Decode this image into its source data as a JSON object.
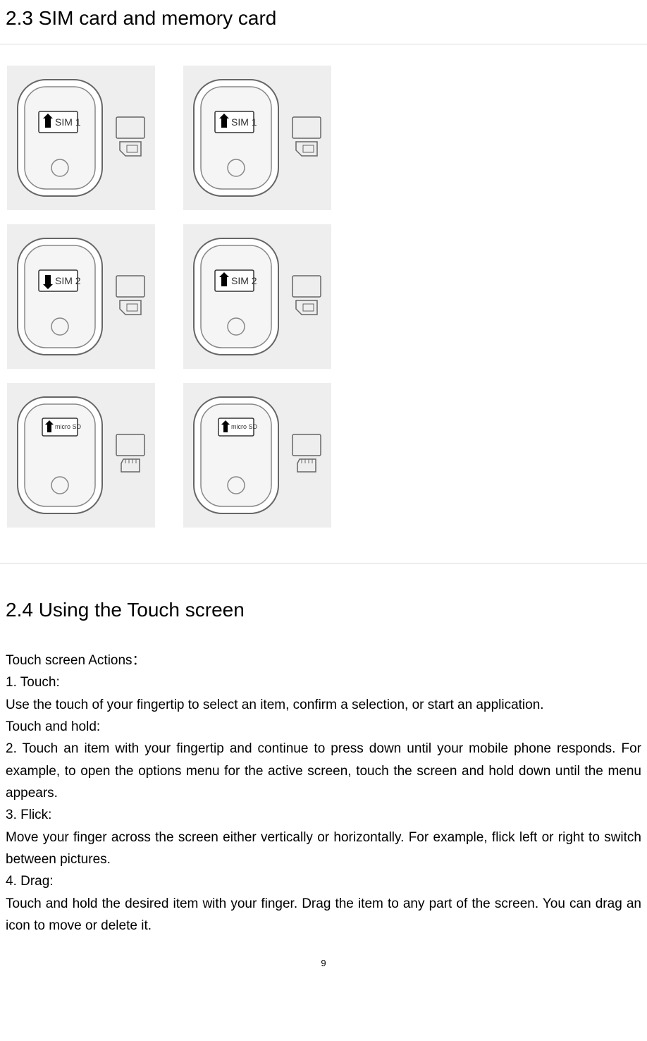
{
  "section1": {
    "heading": "2.3 SIM card and memory card"
  },
  "diagram": {
    "sim1": "SIM 1",
    "sim2": "SIM 2",
    "microsd": "micro SD"
  },
  "section2": {
    "heading": "2.4 Using the Touch screen",
    "intro": "Touch screen Actions：",
    "item1_title": "1. Touch:",
    "item1_body": "Use the touch of your fingertip to select an item, confirm a selection, or start an application.",
    "item1b_title": "Touch and hold:",
    "item2_body": "2. Touch an item with your fingertip and continue to press down until your mobile phone responds. For example, to open the options menu for the active screen, touch the screen and hold down until the menu appears.",
    "item3_title": "3. Flick:",
    "item3_body": "Move your finger across the screen either vertically or horizontally. For example, flick left or right to switch between pictures.",
    "item4_title": "4. Drag:",
    "item4_body": "Touch and hold the desired item with your finger. Drag the item to any part of the screen. You can drag an icon to move or delete it."
  },
  "page": {
    "number": "9"
  }
}
